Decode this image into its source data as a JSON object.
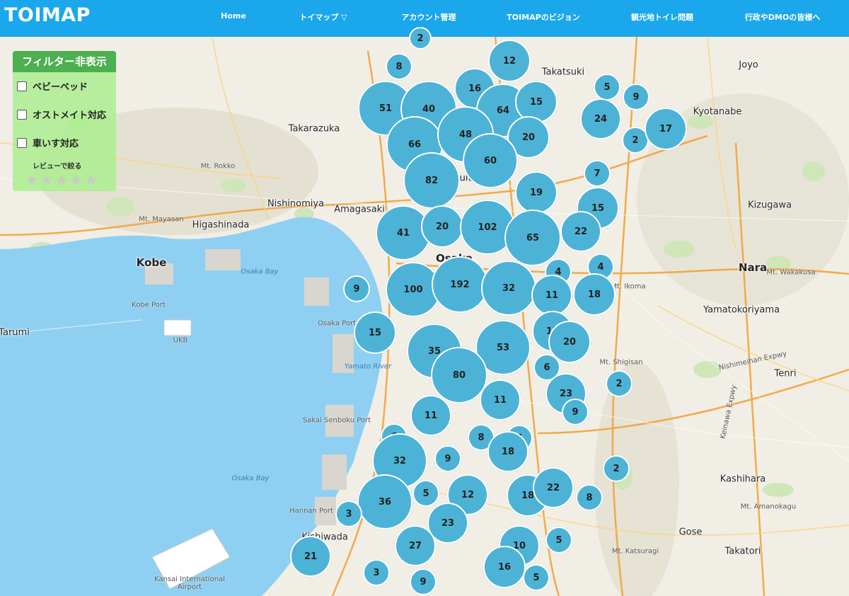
{
  "header": {
    "logo": "TOIMAP",
    "nav": [
      "Home",
      "トイマップ ▽",
      "アカウント管理",
      "TOIMAPのビジョン",
      "観光地トイレ問題",
      "行政やDMOの皆様へ"
    ]
  },
  "filter": {
    "title": "フィルター非表示",
    "options": [
      "ベビーベッド",
      "オストメイト対応",
      "車いす対応"
    ],
    "review_label": "レビューで絞る",
    "stars": [
      "★",
      "★",
      "★",
      "★",
      "★"
    ]
  },
  "map": {
    "places": [
      "Takatsuki",
      "Joyo",
      "Kyotanabe",
      "Takarazuka",
      "Mt. Rokko",
      "Nishinomiya",
      "Amagasaki",
      "Kizugawa",
      "Mt. Mayasan",
      "Higashinada",
      "Kobe",
      "Kobe Port",
      "Nara",
      "Mt. Wakakusa",
      "Mt. Ikoma",
      "Yamatokoriyama",
      "Tarumi",
      "UKB",
      "Osaka Port",
      "Mt. Shigisan",
      "Nishimeihan Expwy",
      "Tenri",
      "Keinawa Expwy",
      "Sakai Senboku Port",
      "Kashihara",
      "Mt. Amanokagu",
      "Hannan Port",
      "Gose",
      "Takatori",
      "Mt. Katsuragi",
      "Kishiwada",
      "Kansai International Airport",
      "Osaka",
      "Suita"
    ],
    "water_labels": [
      "Osaka Bay",
      "Yamato River",
      "Osaka Bay"
    ],
    "clusters": [
      "2",
      "8",
      "12",
      "16",
      "51",
      "40",
      "64",
      "15",
      "5",
      "9",
      "66",
      "48",
      "20",
      "24",
      "2",
      "17",
      "60",
      "82",
      "7",
      "19",
      "15",
      "41",
      "20",
      "102",
      "65",
      "22",
      "4",
      "4",
      "9",
      "100",
      "192",
      "32",
      "11",
      "18",
      "15",
      "12",
      "20",
      "35",
      "53",
      "80",
      "6",
      "23",
      "2",
      "11",
      "11",
      "9",
      "6",
      "8",
      "5",
      "18",
      "32",
      "9",
      "2",
      "5",
      "12",
      "36",
      "3",
      "18",
      "22",
      "8",
      "23",
      "27",
      "10",
      "5",
      "21",
      "16",
      "3",
      "9",
      "5"
    ]
  },
  "colors": {
    "header": "#1aa7ec",
    "cluster": "#4db3d6",
    "sea": "#8fd0f2",
    "filter_title": "#4caf50",
    "filter_panel": "#aaee8c"
  }
}
